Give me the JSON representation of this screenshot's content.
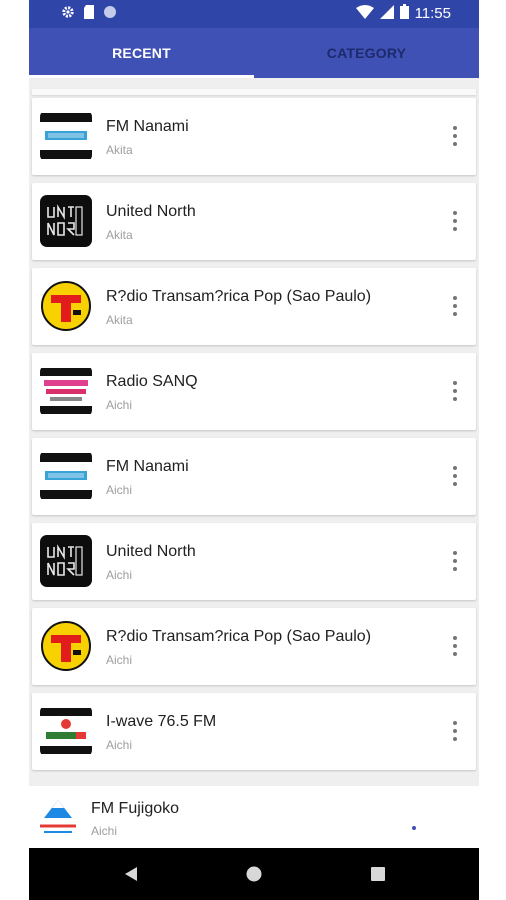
{
  "status_bar": {
    "time": "11:55"
  },
  "tabs": [
    {
      "label": "RECENT",
      "selected": true
    },
    {
      "label": "CATEGORY",
      "selected": false
    }
  ],
  "stations": [
    {
      "name": "FM Nanami",
      "region": "Akita",
      "logo": "fm-nanami-logo"
    },
    {
      "name": "United North",
      "region": "Akita",
      "logo": "united-north-logo"
    },
    {
      "name": "R?dio Transam?rica Pop (Sao Paulo)",
      "region": "Akita",
      "logo": "transamerica-logo"
    },
    {
      "name": "Radio SANQ",
      "region": "Aichi",
      "logo": "radio-sanq-logo"
    },
    {
      "name": "FM Nanami",
      "region": "Aichi",
      "logo": "fm-nanami-logo"
    },
    {
      "name": "United North",
      "region": "Aichi",
      "logo": "united-north-logo"
    },
    {
      "name": "R?dio Transam?rica Pop (Sao Paulo)",
      "region": "Aichi",
      "logo": "transamerica-logo"
    },
    {
      "name": "I-wave 76.5 FM",
      "region": "Aichi",
      "logo": "i-wave-logo"
    }
  ],
  "partial_station": {
    "name": "FM Fujigoko",
    "region": "Aichi",
    "logo": "fm-fujigoko-logo"
  },
  "colors": {
    "appbar": "#3f51b5",
    "statusbar": "#2f46a8",
    "accent": "#ffffff"
  }
}
